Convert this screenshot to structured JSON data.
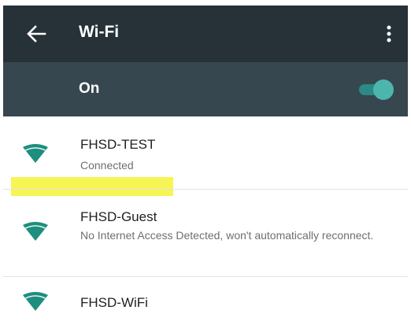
{
  "app_bar": {
    "title": "Wi-Fi",
    "back_icon": "arrow-back-icon",
    "menu_icon": "more-vert-icon",
    "background": "#263238"
  },
  "wifi_toggle": {
    "label": "On",
    "state": "on",
    "background": "#37474f",
    "accent": "#4db6ac"
  },
  "networks": [
    {
      "name": "FHSD-TEST",
      "status": "Connected",
      "icon": "wifi-signal-icon",
      "icon_color": "#1e8e7e"
    },
    {
      "name": "FHSD-Guest",
      "status": "No Internet Access Detected, won't automatically reconnect.",
      "icon": "wifi-signal-icon",
      "icon_color": "#1e8e7e"
    },
    {
      "name": "FHSD-WiFi",
      "status": "",
      "icon": "wifi-signal-icon",
      "icon_color": "#1e8e7e",
      "highlighted": true,
      "highlight_color": "#f7f44b"
    }
  ]
}
